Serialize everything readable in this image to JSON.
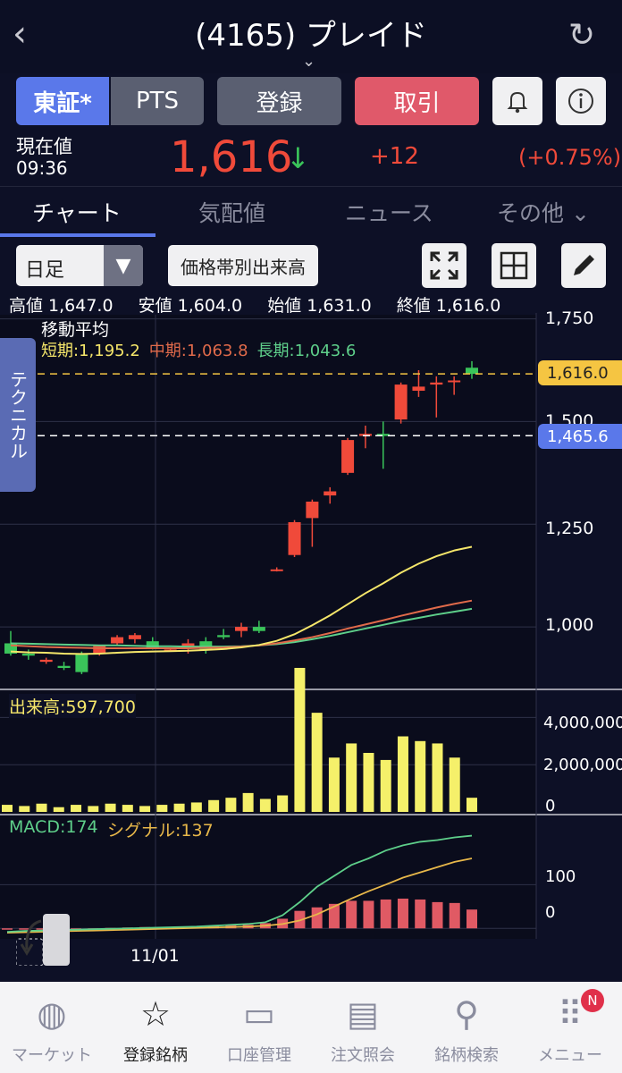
{
  "header": {
    "back_icon": "chevron-left-icon",
    "title": "(4165) プレイド",
    "expand_icon": "chevron-down-icon",
    "reload_icon": "reload-icon"
  },
  "buttons": {
    "tosho": "東証*",
    "pts": "PTS",
    "register": "登録",
    "trade": "取引",
    "bell_icon": "bell-icon",
    "info_icon": "info-icon"
  },
  "quote": {
    "label": "現在値",
    "time": "09:36",
    "price": "1,616",
    "arrow": "↓",
    "change": "+12",
    "change_pct": "(+0.75%)"
  },
  "tabs": [
    "チャート",
    "気配値",
    "ニュース",
    "その他 ⌄"
  ],
  "controls": {
    "period": "日足",
    "volume_profile": "価格帯別出来高",
    "expand_icon": "expand-icon",
    "grid_icon": "grid-icon",
    "pen_icon": "pen-icon"
  },
  "ohlc": {
    "high_label": "高値",
    "high": "1,647.0",
    "low_label": "安値",
    "low": "1,604.0",
    "open_label": "始値",
    "open": "1,631.0",
    "close_label": "終値",
    "close": "1,616.0"
  },
  "ma": {
    "title": "移動平均",
    "short": "短期:1,195.2",
    "mid": "中期:1,063.8",
    "long": "長期:1,043.6"
  },
  "technical_tab": "テクニカル",
  "price_axis": [
    "1,750",
    "1,500",
    "1,250",
    "1,000"
  ],
  "price_tags": {
    "current": "1,616.0",
    "other": "1,465.6"
  },
  "volume": {
    "label": "出来高:597,700",
    "axis": [
      "4,000,000",
      "2,000,000",
      "0"
    ]
  },
  "macd": {
    "label": "MACD:174",
    "signal": "シグナル:137",
    "axis": [
      "100",
      "0"
    ]
  },
  "x_label": "11/01",
  "colors": {
    "up": "#f04a3a",
    "down": "#3ac45a",
    "accent": "#5a78ea",
    "short_ma": "#f5e66a",
    "mid_ma": "#e06a4a",
    "long_ma": "#5ecf8a"
  },
  "chart_data": [
    {
      "type": "candlestick",
      "title": "",
      "ylim": [
        850,
        1760
      ],
      "candles": [
        {
          "o": 960,
          "h": 990,
          "l": 930,
          "c": 935
        },
        {
          "o": 935,
          "h": 945,
          "l": 920,
          "c": 930
        },
        {
          "o": 915,
          "h": 925,
          "l": 910,
          "c": 920
        },
        {
          "o": 905,
          "h": 915,
          "l": 895,
          "c": 900
        },
        {
          "o": 935,
          "h": 940,
          "l": 885,
          "c": 890
        },
        {
          "o": 935,
          "h": 955,
          "l": 930,
          "c": 955
        },
        {
          "o": 960,
          "h": 980,
          "l": 955,
          "c": 975
        },
        {
          "o": 970,
          "h": 985,
          "l": 960,
          "c": 980
        },
        {
          "o": 965,
          "h": 975,
          "l": 945,
          "c": 950
        },
        {
          "o": 945,
          "h": 950,
          "l": 940,
          "c": 945
        },
        {
          "o": 950,
          "h": 970,
          "l": 935,
          "c": 960
        },
        {
          "o": 965,
          "h": 975,
          "l": 935,
          "c": 945
        },
        {
          "o": 980,
          "h": 995,
          "l": 970,
          "c": 975
        },
        {
          "o": 990,
          "h": 1010,
          "l": 975,
          "c": 1000
        },
        {
          "o": 1000,
          "h": 1015,
          "l": 985,
          "c": 990
        },
        {
          "o": 1140,
          "h": 1145,
          "l": 1135,
          "c": 1140
        },
        {
          "o": 1175,
          "h": 1260,
          "l": 1170,
          "c": 1255
        },
        {
          "o": 1265,
          "h": 1310,
          "l": 1195,
          "c": 1305
        },
        {
          "o": 1320,
          "h": 1340,
          "l": 1300,
          "c": 1330
        },
        {
          "o": 1375,
          "h": 1460,
          "l": 1370,
          "c": 1455
        },
        {
          "o": 1465,
          "h": 1490,
          "l": 1435,
          "c": 1470
        },
        {
          "o": 1470,
          "h": 1500,
          "l": 1385,
          "c": 1465
        },
        {
          "o": 1505,
          "h": 1595,
          "l": 1495,
          "c": 1590
        },
        {
          "o": 1575,
          "h": 1625,
          "l": 1560,
          "c": 1585
        },
        {
          "o": 1590,
          "h": 1610,
          "l": 1510,
          "c": 1595
        },
        {
          "o": 1600,
          "h": 1610,
          "l": 1565,
          "c": 1600
        },
        {
          "o": 1631,
          "h": 1647,
          "l": 1604,
          "c": 1616
        }
      ],
      "ma_short": [
        940,
        938,
        937,
        935,
        934,
        935,
        937,
        939,
        940,
        941,
        942,
        944,
        946,
        950,
        956,
        966,
        982,
        1004,
        1028,
        1055,
        1082,
        1106,
        1132,
        1154,
        1172,
        1186,
        1195
      ],
      "ma_mid": [
        955,
        953,
        951,
        950,
        949,
        948,
        948,
        948,
        948,
        948,
        948,
        949,
        950,
        952,
        955,
        960,
        967,
        975,
        985,
        996,
        1006,
        1016,
        1027,
        1037,
        1047,
        1056,
        1064
      ],
      "ma_long": [
        960,
        959,
        958,
        957,
        956,
        955,
        955,
        954,
        953,
        953,
        952,
        952,
        952,
        953,
        955,
        958,
        963,
        970,
        978,
        987,
        996,
        1005,
        1014,
        1022,
        1030,
        1037,
        1044
      ],
      "yticks": [
        1750,
        1500,
        1250,
        1000
      ]
    },
    {
      "type": "bar",
      "title": "出来高",
      "ylim": [
        0,
        5000000
      ],
      "values": [
        300000,
        250000,
        350000,
        200000,
        300000,
        250000,
        350000,
        300000,
        250000,
        300000,
        350000,
        400000,
        500000,
        600000,
        800000,
        550000,
        700000,
        6100000,
        4200000,
        2300000,
        2900000,
        2500000,
        2200000,
        3200000,
        3000000,
        2900000,
        2300000,
        600000
      ]
    },
    {
      "type": "bar",
      "title": "MACD",
      "ylim": [
        -20,
        250
      ],
      "hist": [
        0,
        0,
        0,
        0,
        0,
        0,
        1,
        2,
        3,
        3,
        4,
        5,
        6,
        7,
        8,
        12,
        22,
        40,
        48,
        56,
        63,
        63,
        66,
        68,
        66,
        60,
        58,
        43
      ],
      "macd": [
        -8,
        -6,
        -5,
        -4,
        -3,
        -2,
        -1,
        0,
        1,
        2,
        3,
        4,
        6,
        8,
        10,
        14,
        30,
        60,
        95,
        120,
        145,
        160,
        178,
        190,
        198,
        202,
        208,
        212
      ],
      "signal": [
        -10,
        -9,
        -8,
        -7,
        -6,
        -5,
        -4,
        -3,
        -2,
        -1,
        0,
        1,
        2,
        3,
        4,
        6,
        10,
        18,
        32,
        50,
        68,
        85,
        100,
        116,
        128,
        140,
        152,
        160
      ]
    }
  ],
  "nav": [
    {
      "icon": "globe-icon",
      "glyph": "◍",
      "label": "マーケット"
    },
    {
      "icon": "star-icon",
      "glyph": "☆",
      "label": "登録銘柄"
    },
    {
      "icon": "card-icon",
      "glyph": "▭",
      "label": "口座管理"
    },
    {
      "icon": "document-icon",
      "glyph": "▤",
      "label": "注文照会"
    },
    {
      "icon": "search-icon",
      "glyph": "⚲",
      "label": "銘柄検索"
    },
    {
      "icon": "menu-grid-icon",
      "glyph": "⠿",
      "label": "メニュー"
    }
  ],
  "badge": "N"
}
